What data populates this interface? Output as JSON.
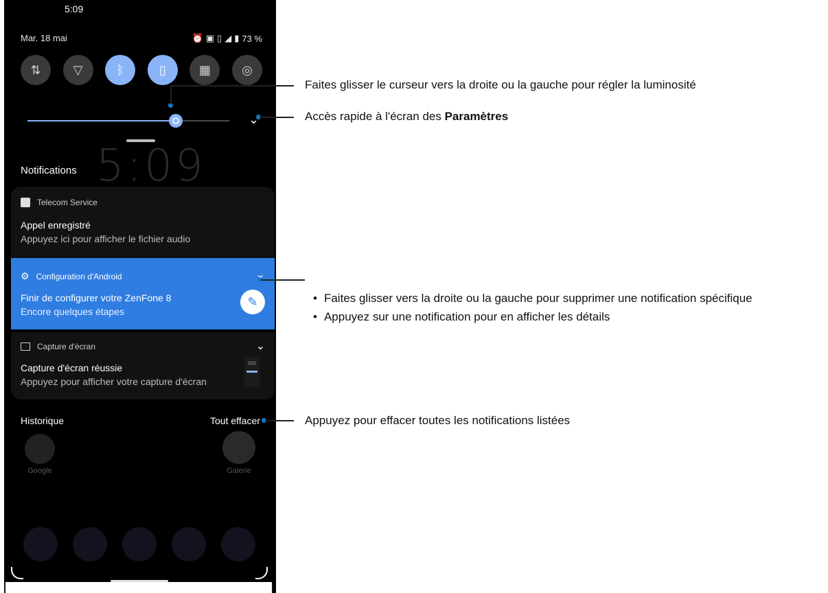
{
  "status_bar": {
    "time": "5:09",
    "date": "Mar. 18 mai",
    "battery": "73 %"
  },
  "quick_settings": [
    {
      "name": "data-icon",
      "glyph": "⇅",
      "on": false
    },
    {
      "name": "wifi-icon",
      "glyph": "▽",
      "on": false
    },
    {
      "name": "bluetooth-icon",
      "glyph": "ᛒ",
      "on": true
    },
    {
      "name": "vibrate-icon",
      "glyph": "▯",
      "on": true
    },
    {
      "name": "qr-icon",
      "glyph": "▦",
      "on": false
    },
    {
      "name": "hotspot-icon",
      "glyph": "◎",
      "on": false
    }
  ],
  "brightness": {
    "level": 0.72
  },
  "lockscreen_clock": "5:09",
  "notifications": {
    "title": "Notifications",
    "items": [
      {
        "app": "Telecom Service",
        "title": "Appel enregistré",
        "body": "Appuyez ici pour afficher le fichier audio"
      },
      {
        "app": "Configuration d'Android",
        "title": "Finir de configurer votre ZenFone 8",
        "body": "Encore quelques étapes"
      },
      {
        "app": "Capture d'écran",
        "title": "Capture d'écran réussie",
        "body": "Appuyez pour afficher votre capture d'écran"
      }
    ],
    "history_label": "Historique",
    "clear_all_label": "Tout effacer"
  },
  "home_apps": {
    "left": "Google",
    "right": "Galerie"
  },
  "annotations": {
    "brightness": "Faites glisser le curseur vers la droite ou la gauche pour régler la luminosité",
    "settings_prefix": "Accès rapide à l'écran des ",
    "settings_bold": "Paramètres",
    "swipe": "Faites glisser vers la droite ou la gauche pour supprimer une notification spécifique",
    "tap": "Appuyez sur une notification pour en afficher les détails",
    "clear": "Appuyez pour effacer toutes les notifications listées"
  },
  "colors": {
    "accent": "#8ab4f8",
    "notification_highlight": "#2f7de1",
    "callout_dot": "#1479c8"
  }
}
